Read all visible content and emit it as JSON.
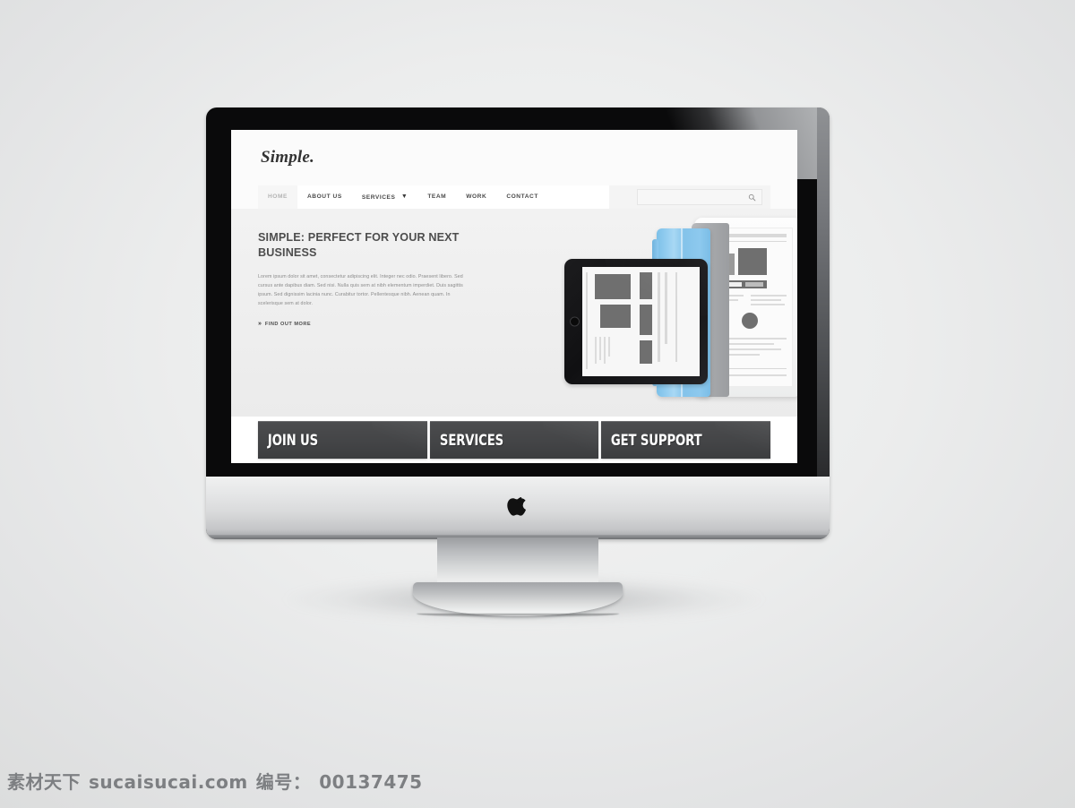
{
  "scene": {
    "device": "imac-monitor",
    "brand_logo": "apple-logo"
  },
  "website": {
    "logo": "Simple.",
    "nav": [
      {
        "label": "HOME",
        "active": true,
        "caret": false
      },
      {
        "label": "ABOUT US",
        "active": false,
        "caret": false
      },
      {
        "label": "SERVICES",
        "active": false,
        "caret": true
      },
      {
        "label": "TEAM",
        "active": false,
        "caret": false
      },
      {
        "label": "WORK",
        "active": false,
        "caret": false
      },
      {
        "label": "CONTACT",
        "active": false,
        "caret": false
      }
    ],
    "search": {
      "value": "",
      "placeholder": "",
      "icon": "search-icon"
    },
    "hero": {
      "title": "SIMPLE: PERFECT FOR YOUR NEXT BUSINESS",
      "body": "Lorem ipsum dolor sit amet, consectetur adipiscing elit. Integer nec odio. Praesent libero. Sed cursus ante dapibus diam. Sed nisi. Nulla quis sem at nibh elementum imperdiet. Duis sagittis ipsum. Sed dignissim lacinia nunc. Curabitur tortor. Pellentesque nibh. Aenean quam. In scelerisque sem at dolor.",
      "cta_link": "FIND OUT MORE",
      "cta_chevron": "»"
    },
    "illustration": {
      "tablet_black": "tablet-landscape-black",
      "tablet_white": "tablet-portrait-white",
      "cover_color": "#8ec9ee",
      "cover_back_color": "#a9abae"
    },
    "cta_buttons": [
      {
        "label": "JOIN US"
      },
      {
        "label": "SERVICES"
      },
      {
        "label": "GET SUPPORT"
      }
    ]
  },
  "watermark": {
    "source": "素材天下",
    "site": "sucaisucai.com",
    "id_label": "编号：",
    "id_value": "00137475"
  },
  "colors": {
    "bezel": "#0a0a0b",
    "chin": "#e6e7e8",
    "cta_button": "#444547",
    "nav_active": "#b4b4b4",
    "accent_blue": "#8ec9ee"
  }
}
